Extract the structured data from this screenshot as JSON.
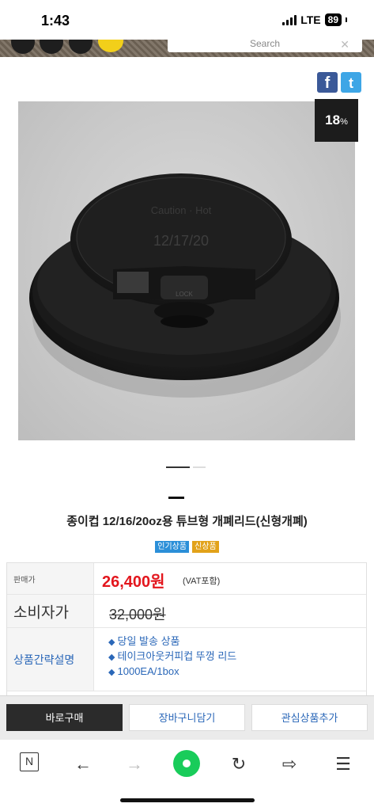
{
  "status_bar": {
    "time": "1:43",
    "network": "LTE",
    "battery": "89"
  },
  "header": {
    "search_placeholder": "Search"
  },
  "share": {
    "facebook": "f",
    "twitter": "t"
  },
  "product": {
    "discount_value": "18",
    "discount_unit": "%",
    "title": "종이컵 12/16/20oz용 튜브형 개폐리드(신형개폐)",
    "badges": [
      "인기상품",
      "신상품"
    ],
    "carousel_active_index": 0,
    "lid_text": {
      "top": "Caution · Hot",
      "date": "12/17/20",
      "lock": "LOCK"
    }
  },
  "info_table": {
    "sale_label": "판매가",
    "sale_price": "26,400원",
    "vat_note": "(VAT포함)",
    "consumer_label": "소비자가",
    "consumer_price": "32,000원",
    "summary_label": "상품간략설명",
    "summary_items": [
      "당일 발송 상품",
      "테이크아웃커피컵 뚜껑 리드",
      "1000EA/1box"
    ]
  },
  "actions": {
    "buy_now": "바로구매",
    "add_cart": "장바구니담기",
    "add_wishlist": "관심상품추가"
  },
  "browser": {
    "n_label": "N"
  },
  "colors": {
    "price_red": "#e3161d",
    "link_blue": "#2a67b8",
    "popular_badge": "#2b8fd8",
    "new_badge": "#e2a21a",
    "browser_green": "#19cc5a",
    "facebook": "#3b5998",
    "twitter": "#3ea6e6"
  }
}
